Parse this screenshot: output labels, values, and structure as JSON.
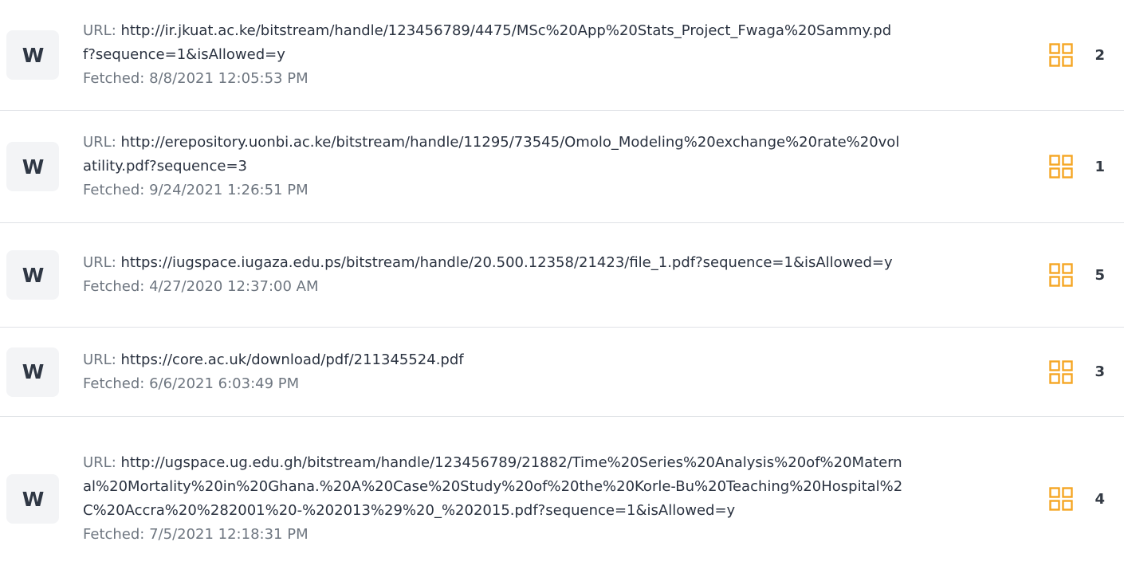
{
  "colors": {
    "accent": "#f5a623",
    "text": "#333a44",
    "muted": "#6e7680",
    "tile_bg": "#f3f4f6",
    "divider": "#dfe2e6"
  },
  "labels": {
    "url_prefix": "URL: ",
    "fetched_prefix": "Fetched: "
  },
  "sources": [
    {
      "tile_letter": "W",
      "icon": "grid-icon",
      "url": "http://ir.jkuat.ac.ke/bitstream/handle/123456789/4475/MSc%20App%20Stats_Project_Fwaga%20Sammy.pdf?sequence=1&isAllowed=y",
      "fetched": "8/8/2021 12:05:53 PM",
      "count": "2"
    },
    {
      "tile_letter": "W",
      "icon": "grid-icon",
      "url": "http://erepository.uonbi.ac.ke/bitstream/handle/11295/73545/Omolo_Modeling%20exchange%20rate%20volatility.pdf?sequence=3",
      "fetched": "9/24/2021 1:26:51 PM",
      "count": "1"
    },
    {
      "tile_letter": "W",
      "icon": "grid-icon",
      "url": "https://iugspace.iugaza.edu.ps/bitstream/handle/20.500.12358/21423/file_1.pdf?sequence=1&isAllowed=y",
      "fetched": "4/27/2020 12:37:00 AM",
      "count": "5"
    },
    {
      "tile_letter": "W",
      "icon": "grid-icon",
      "url": "https://core.ac.uk/download/pdf/211345524.pdf",
      "fetched": "6/6/2021 6:03:49 PM",
      "count": "3"
    },
    {
      "tile_letter": "W",
      "icon": "grid-icon",
      "url": "http://ugspace.ug.edu.gh/bitstream/handle/123456789/21882/Time%20Series%20Analysis%20of%20Maternal%20Mortality%20in%20Ghana.%20A%20Case%20Study%20of%20the%20Korle-Bu%20Teaching%20Hospital%2C%20Accra%20%282001%20-%202013%29%20_%202015.pdf?sequence=1&isAllowed=y",
      "fetched": "7/5/2021 12:18:31 PM",
      "count": "4"
    }
  ]
}
